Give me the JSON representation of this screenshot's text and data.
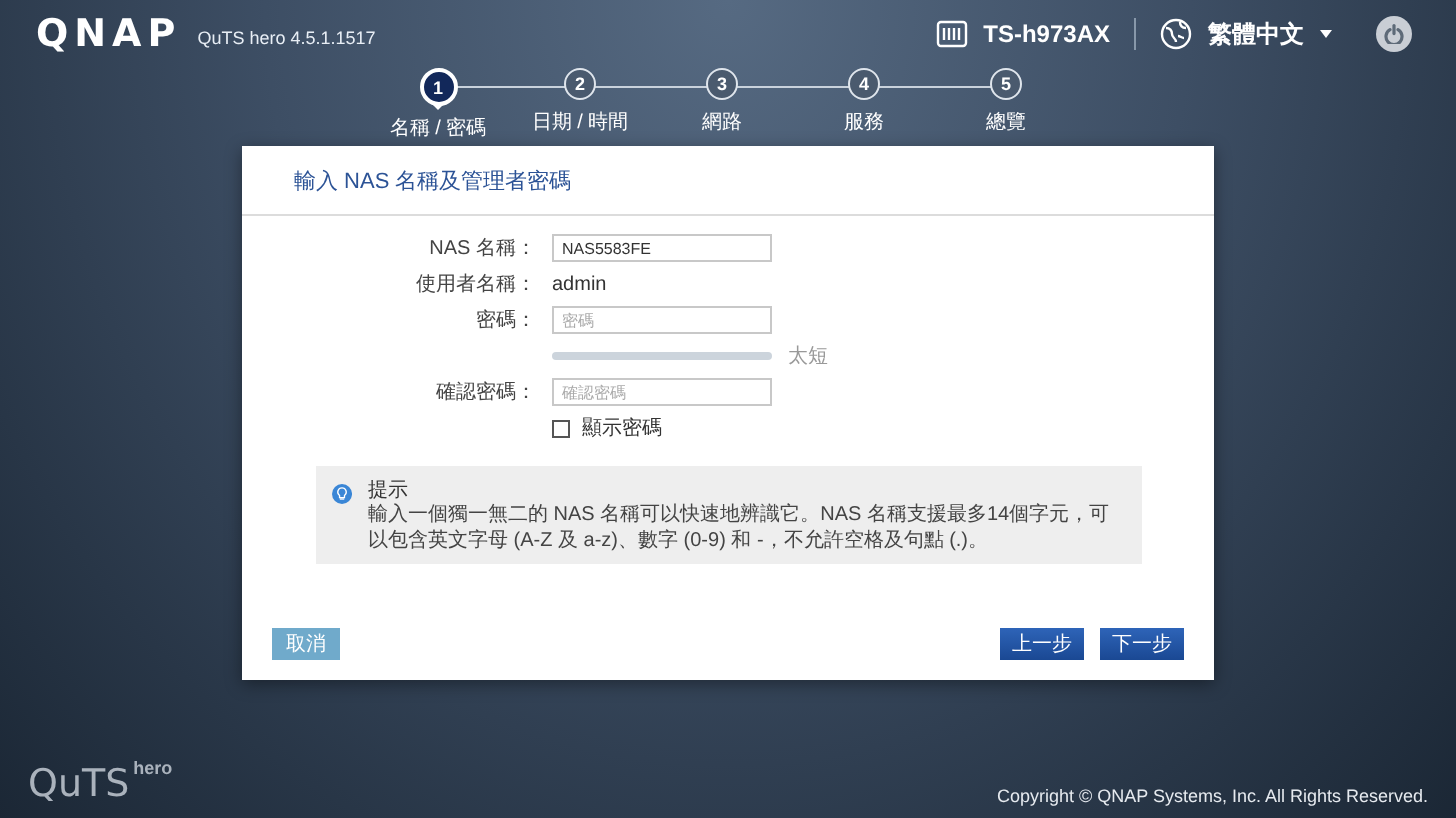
{
  "header": {
    "logo": "QNAP",
    "version": "QuTS hero 4.5.1.1517",
    "device": "TS-h973AX",
    "language": "繁體中文"
  },
  "steps": [
    {
      "number": "1",
      "label": "名稱 / 密碼",
      "selected": true
    },
    {
      "number": "2",
      "label": "日期 / 時間",
      "selected": false
    },
    {
      "number": "3",
      "label": "網路",
      "selected": false
    },
    {
      "number": "4",
      "label": "服務",
      "selected": false
    },
    {
      "number": "5",
      "label": "總覽",
      "selected": false
    }
  ],
  "card": {
    "title": "輸入 NAS 名稱及管理者密碼",
    "form": [
      {
        "kind": "input",
        "label": "NAS 名稱：",
        "value": "NAS5583FE"
      },
      {
        "kind": "text",
        "label": "使用者名稱：",
        "value": "admin"
      },
      {
        "kind": "password",
        "label": "密碼：",
        "placeholder": "密碼"
      },
      {
        "kind": "meter",
        "level": 0,
        "reading": "太短"
      },
      {
        "kind": "password",
        "label": "確認密碼：",
        "placeholder": "確認密碼"
      },
      {
        "kind": "checkbox",
        "label": "顯示密碼",
        "checked": false
      }
    ],
    "hint": {
      "title": "提示",
      "text": "輸入一個獨一無二的 NAS 名稱可以快速地辨識它。NAS 名稱支援最多14個字元，可以包含英文字母 (A-Z 及 a-z)、數字 (0-9) 和 -，不允許空格及句點 (.)。"
    },
    "buttons": {
      "cancel": "取消",
      "back": "上一步",
      "next": "下一步"
    }
  },
  "footer": {
    "brand": "QuTS",
    "brand_tag": "hero",
    "copyright": "Copyright © QNAP Systems, Inc. All Rights Reserved."
  }
}
